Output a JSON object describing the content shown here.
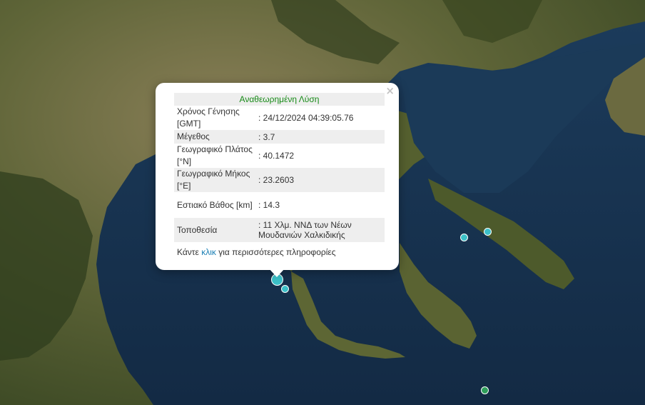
{
  "popup": {
    "title": "Αναθεωρημένη Λύση",
    "close": "×",
    "rows": [
      {
        "label": "Χρόνος Γένησης [GMT]",
        "value": ": 24/12/2024 04:39:05.76"
      },
      {
        "label": "Μέγεθος",
        "value": ": 3.7"
      },
      {
        "label": "Γεωγραφικό Πλάτος [°N]",
        "value": ": 40.1472"
      },
      {
        "label": "Γεωγραφικό Μήκος [°E]",
        "value": ": 23.2603"
      },
      {
        "label": "Εστιακό Βάθος [km]",
        "value": ": 14.3"
      },
      {
        "label": "Τοποθεσία",
        "value": ": 11 Χλμ. ΝΝΔ των Νέων Μουδανιών Χαλκιδικής"
      }
    ],
    "footer": {
      "before": "Κάντε ",
      "link": "κλικ",
      "after": " για περισσότερες πληροφορίες"
    }
  },
  "colors": {
    "sea": "#173350",
    "land": "#4f5a2e",
    "marker_cyan": "#3cc0c8",
    "marker_green": "#2e9e5a",
    "title_green": "#168a16",
    "link_blue": "#1a7fb5"
  }
}
